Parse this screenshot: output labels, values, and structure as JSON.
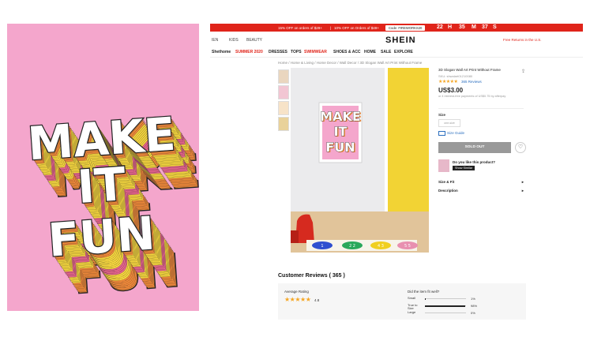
{
  "poster": {
    "lines": [
      "MAKE",
      "IT",
      "FUN"
    ],
    "colors": {
      "background": "#f4a6cc",
      "yellow": "#f9d93f",
      "orange": "#f28a3a",
      "pink": "#e9658f",
      "outline": "#222222",
      "fill": "#ffffff"
    }
  },
  "promo": {
    "text_1": "15% OFF on orders of $29+",
    "separator": "|",
    "text_2": "10% OFF on Orders of $49+",
    "code": "Code: FIREWORKS20",
    "countdown": [
      "22",
      "H",
      "35",
      "M",
      "37",
      "S"
    ]
  },
  "nav": {
    "left_links": [
      "IEN",
      "KIDS",
      "BEAUTY"
    ],
    "logo": "SHEIN",
    "free_returns": "Free Returns in the U.S."
  },
  "categories": [
    "Shethome",
    "SUMMER 2020",
    "DRESSES",
    "TOPS",
    "SWIMWEAR",
    "SHOES & ACC",
    "HOME",
    "SALE",
    "EXPLORE"
  ],
  "breadcrumb": "Home  /  Home & Living  /  Home Decor  /  Wall Decor  /  3D Slogan Wall Art Print Without Frame",
  "hopscotch": [
    "1",
    "2 2",
    "4 3",
    "5 5"
  ],
  "product": {
    "title": "3D Slogan Wall Art Print Without Frame",
    "sku": "SKU: shwalart01210080",
    "stars": "★★★★★",
    "reviews_link": "365 Reviews",
    "price": "US$3.00",
    "afterpay": "or 4 interest-free payments of US$0.75 by afterpay",
    "size_label": "Size",
    "size_option": "one-size",
    "size_guide": "Size Guide",
    "sold_out": "SOLD OUT",
    "heart_icon": "♡",
    "like_question": "Do you like this product?",
    "show_similar": "Show Similar",
    "size_fit": "Size & Fit",
    "description": "Description",
    "chevron": "▸"
  },
  "reviews": {
    "title": "Customer Reviews ( 365 )",
    "average_label": "Average Rating",
    "average_stars": "★★★★★",
    "average_value": "4.8",
    "fit_question": "Did the item fit well?",
    "fit": [
      {
        "label": "Small",
        "percent": "1%",
        "fraction": 0.01
      },
      {
        "label": "True to Size",
        "percent": "98%",
        "fraction": 0.98
      },
      {
        "label": "Large",
        "percent": "0%",
        "fraction": 0.0
      }
    ]
  }
}
